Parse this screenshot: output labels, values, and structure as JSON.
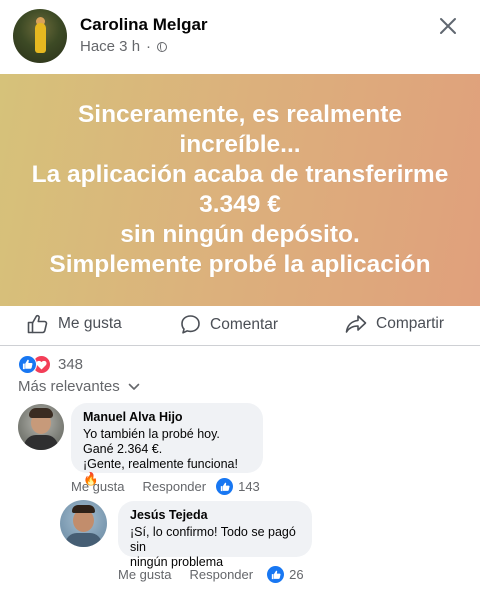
{
  "post": {
    "author": "Carolina Melgar",
    "time": "Hace 3 h",
    "separator": "·",
    "privacy_icon": "globe-icon",
    "text": "Sinceramente, es realmente\nincreíble...\nLa aplicación acaba de transferirme\n3.349 €\nsin ningún depósito.\nSimplemente probé la aplicación"
  },
  "actions": {
    "like": "Me gusta",
    "comment": "Comentar",
    "share": "Compartir"
  },
  "reactions": {
    "count": "348",
    "icons": [
      "like-icon",
      "love-icon"
    ]
  },
  "sort": {
    "label": "Más relevantes"
  },
  "comments": [
    {
      "name": "Manuel Alva Hijo",
      "text": "Yo también la probé hoy.\nGané 2.364 €.\n¡Gente, realmente funciona! 🔥",
      "like": "Me gusta",
      "reply": "Responder",
      "likes": "143"
    },
    {
      "name": "Jesús Tejeda",
      "text": "¡Sí, lo confirmo! Todo se pagó sin\nningún problema",
      "like": "Me gusta",
      "reply": "Responder",
      "likes": "26"
    }
  ],
  "colors": {
    "accent": "#1877f2",
    "love": "#f33e58",
    "muted": "#65676b",
    "bubble": "#f0f2f5"
  }
}
